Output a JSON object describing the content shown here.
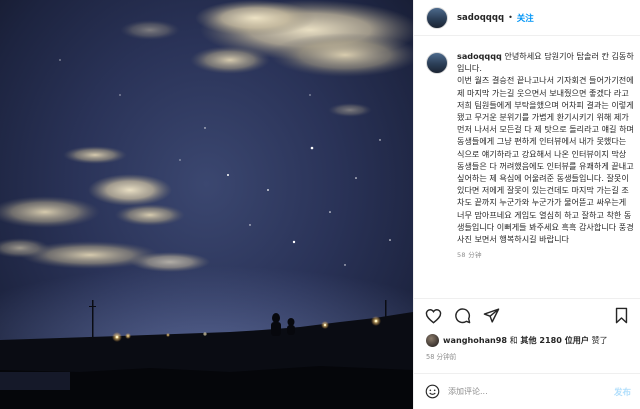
{
  "account": {
    "username": "sadoqqqq",
    "follow_label": "关注"
  },
  "caption": {
    "username": "sadoqqqq",
    "text": "안녕하세요 담원기아 탑솔러 칸 김동하 입니다.\n이번 월즈 결승전 끝나고나서 기자회견 들어가기전에 제 마지막 가는길 웃으면서 보내줬으면 좋겠다 라고 저희 팀원들에게 부탁을했으며 어차피 결과는 이렇게 됐고 무거운 분위기를 가볍게 환기시키기 위해 제가 먼저 나서서 모든걸 다 제 탓으로 돌리라고 얘길 하며 동생들에게 그냥 편하게 인터뷰에서 내가 못했다는 식으로 얘기하라고 강요해서 나온 인터뷰이지 막상 동생들은 다 꺼려했음에도 인터뷰를 유쾌하게 끝내고 싶어하는 제 욕심에 어울려준 동생들입니다. 잘못이 있다면 저에게 잘못이 있는건데도 마지막 가는길 조차도 끝까지 누군가와 누군가가 물어뜯고 싸우는게 너무 맘아프네요 게임도 열심히 하고 잘하고 착한 동생들입니다 이뻐게들 봐주세요 흑흑 감사합니다 풍경사진 보면서 행복하시길 바랍니다",
    "time": "58 分钟"
  },
  "likes": {
    "user": "wanghohan98",
    "connector": "和",
    "others": "其他 2180 位用户",
    "suffix": "赞了"
  },
  "post_time": "58 分钟前",
  "comment": {
    "placeholder": "添加评论...",
    "post_label": "发布"
  },
  "icons": {
    "like": "heart-icon",
    "comment": "comment-icon",
    "share": "paper-plane-icon",
    "save": "bookmark-icon",
    "emoji": "smiley-icon"
  }
}
